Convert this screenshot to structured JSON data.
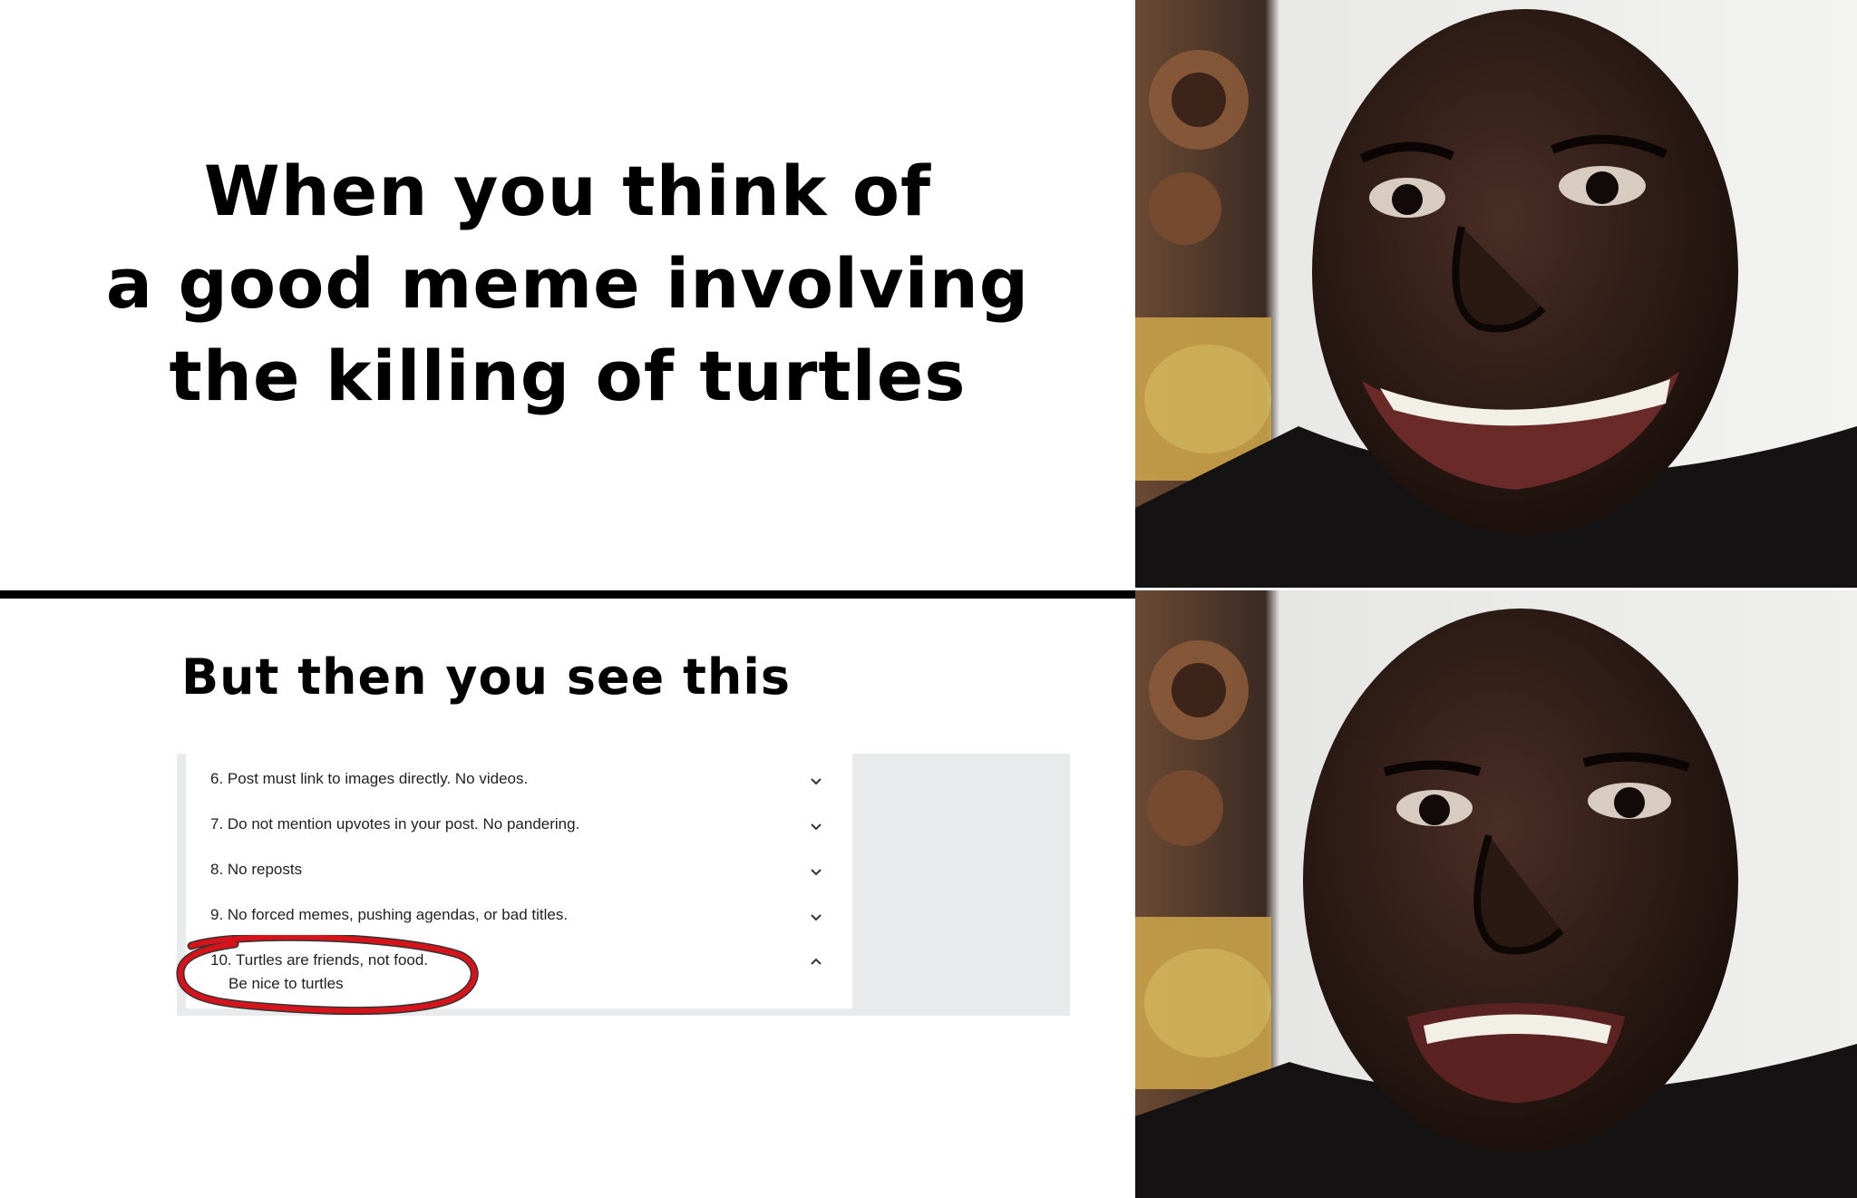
{
  "top_caption": {
    "line1": "When you think of",
    "line2": "a good meme involving",
    "line3": "the killing of turtles"
  },
  "bottom_caption": "But then you see this",
  "rules": [
    {
      "text": "6. Post must link to images directly. No videos.",
      "expanded": false
    },
    {
      "text": "7. Do not mention upvotes in your post. No pandering.",
      "expanded": false
    },
    {
      "text": "8. No reposts",
      "expanded": false
    },
    {
      "text": "9. No forced memes, pushing agendas, or bad titles.",
      "expanded": false
    },
    {
      "text": "10. Turtles are friends, not food.",
      "detail": "Be nice to turtles",
      "expanded": true
    }
  ],
  "colors": {
    "highlight_circle": "#d6121a",
    "sidebar_gray": "#e9eaec"
  },
  "icons": {
    "collapsed": "chevron-down-icon",
    "expanded": "chevron-up-icon"
  },
  "faces": [
    "smiling-man-photo",
    "disappointed-man-photo"
  ]
}
